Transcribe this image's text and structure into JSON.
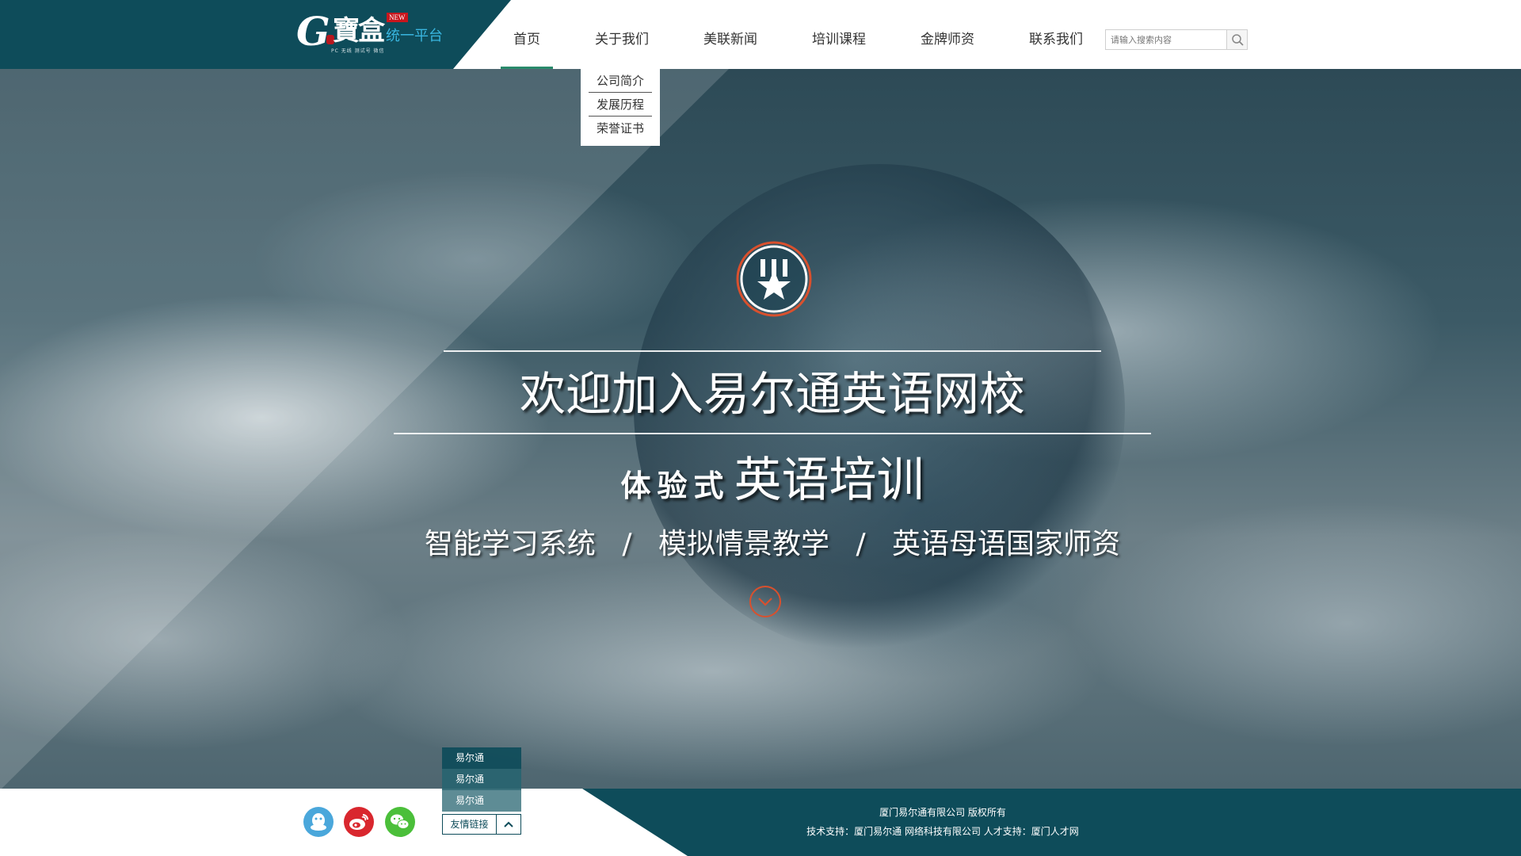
{
  "brand": {
    "logo_mark": "G",
    "logo_name": "寶盒",
    "logo_tagline": "PC 无线 测试号 微信",
    "badge": "NEW",
    "platform": "统一平台"
  },
  "nav": {
    "items": [
      {
        "label": "首页",
        "active": true
      },
      {
        "label": "关于我们",
        "active": false
      },
      {
        "label": "美联新闻",
        "active": false
      },
      {
        "label": "培训课程",
        "active": false
      },
      {
        "label": "金牌师资",
        "active": false
      },
      {
        "label": "联系我们",
        "active": false
      }
    ],
    "dropdown": [
      "公司简介",
      "发展历程",
      "荣誉证书"
    ]
  },
  "search": {
    "placeholder": "请输入搜索内容",
    "value": "",
    "icon": "search-icon"
  },
  "hero": {
    "medal_icon": "medal-star-icon",
    "title": "欢迎加入易尔通英语网校",
    "subtitle_small": "体验式",
    "subtitle_big": "英语培训",
    "features": [
      "智能学习系统",
      "模拟情景教学",
      "英语母语国家师资"
    ],
    "separator": "/",
    "scroll_icon": "chevron-down-icon"
  },
  "footer": {
    "social": [
      {
        "name": "qq-icon",
        "color": "#4aa7db"
      },
      {
        "name": "weibo-icon",
        "color": "#d9272e"
      },
      {
        "name": "wechat-icon",
        "color": "#4bbf3a"
      }
    ],
    "links": [
      "易尔通",
      "易尔通",
      "易尔通"
    ],
    "links_label": "友情链接",
    "copyright": "厦门易尔通有限公司  版权所有",
    "support": "技术支持：厦门易尔通 网络科技有限公司 人才支持：厦门人才网"
  },
  "colors": {
    "brand_dark": "#0e4c5a",
    "accent_orange": "#d9502d",
    "platform_blue": "#39b6e0",
    "nav_active_underline": "#2a8a6b"
  }
}
